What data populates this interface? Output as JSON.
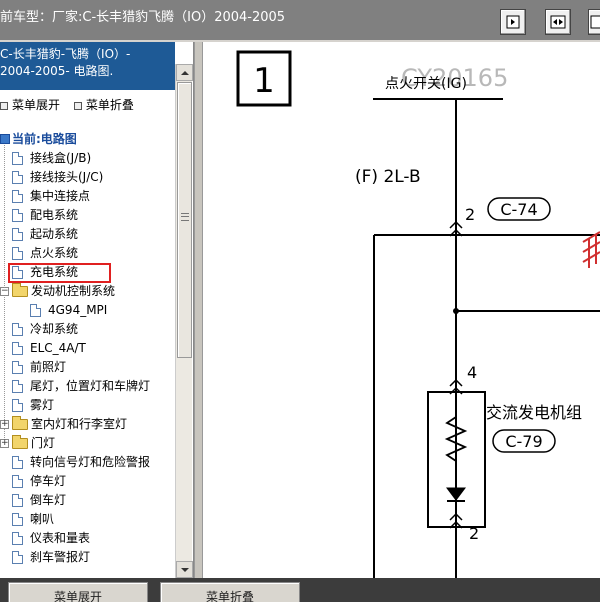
{
  "window": {
    "title": "前车型：厂家:C-长丰猎豹飞腾（IO）2004-2005"
  },
  "toolbar": {
    "icons": [
      "fit-page-icon",
      "fit-width-icon",
      "zoom-icon"
    ]
  },
  "left_panel": {
    "header_line1": "C-长丰猎豹-飞腾（IO）-",
    "header_line2": "2004-2005- 电路图.",
    "expand_all": "菜单展开",
    "collapse_all": "菜单折叠",
    "tree": {
      "root": "当前:电路图",
      "items": [
        {
          "label": "接线盒(J/B)",
          "type": "doc"
        },
        {
          "label": "接线接头(J/C)",
          "type": "doc"
        },
        {
          "label": "集中连接点",
          "type": "doc"
        },
        {
          "label": "配电系统",
          "type": "doc"
        },
        {
          "label": "起动系统",
          "type": "doc"
        },
        {
          "label": "点火系统",
          "type": "doc"
        },
        {
          "label": "充电系统",
          "type": "doc",
          "selected": true
        },
        {
          "label": "发动机控制系统",
          "type": "folder",
          "expanded": true
        },
        {
          "label": "4G94_MPI",
          "type": "doc",
          "child": true
        },
        {
          "label": "冷却系统",
          "type": "doc"
        },
        {
          "label": "ELC_4A/T",
          "type": "doc"
        },
        {
          "label": "前照灯",
          "type": "doc"
        },
        {
          "label": "尾灯，位置灯和车牌灯",
          "type": "doc"
        },
        {
          "label": "雾灯",
          "type": "doc"
        },
        {
          "label": "室内灯和行李室灯",
          "type": "folder"
        },
        {
          "label": "门灯",
          "type": "folder"
        },
        {
          "label": "转向信号灯和危险警报",
          "type": "doc"
        },
        {
          "label": "停车灯",
          "type": "doc"
        },
        {
          "label": "倒车灯",
          "type": "doc"
        },
        {
          "label": "喇叭",
          "type": "doc"
        },
        {
          "label": "仪表和量表",
          "type": "doc"
        },
        {
          "label": "刹车警报灯",
          "type": "doc"
        }
      ]
    }
  },
  "diagram": {
    "page_number": "1",
    "watermark": "CY20165",
    "top_label": "点火开关(IG)",
    "wire_label": "(F) 2L-B",
    "pin_top": "2",
    "connector_top": "C-74",
    "pin_alt": "4",
    "alternator_label": "交流发电机组",
    "connector_alt": "C-79",
    "pin_bottom": "2"
  },
  "bottom_bar": {
    "expand_label": "菜单展开",
    "collapse_label": "菜单折叠"
  }
}
